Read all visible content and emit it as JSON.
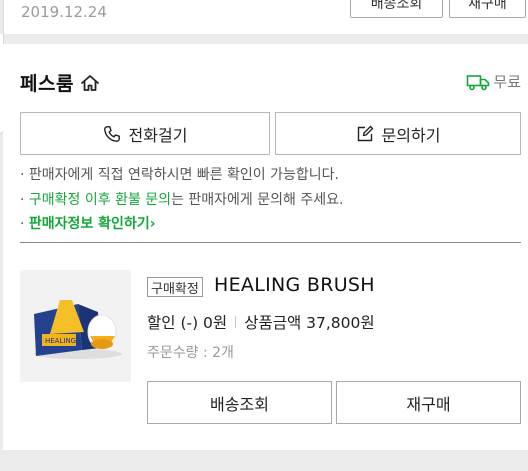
{
  "previous_order": {
    "date": "2019.12.24",
    "button_1": "배송조회",
    "button_2": "재구매"
  },
  "store": {
    "name": "페스룸",
    "home_icon": "home-icon",
    "shipping_label": "무료",
    "shipping_icon": "truck-icon",
    "accent_color": "#13a83a"
  },
  "actions": {
    "call_label": "전화걸기",
    "inquiry_label": "문의하기"
  },
  "notices": {
    "line1": "판매자에게 직접 연락하시면 빠른 확인이 가능합니다.",
    "line2_highlight": "구매확정 이후 환불 문의",
    "line2_rest": "는 판매자에게 문의해 주세요.",
    "line3_link": "판매자정보 확인하기",
    "line3_chevron": "›"
  },
  "item": {
    "status": "구매확정",
    "name": "HEALING BRUSH",
    "discount": "할인 (-) 0원",
    "amount": "상품금액 37,800원",
    "quantity": "주문수량 : 2개",
    "track_label": "배송조회",
    "rebuy_label": "재구매"
  }
}
